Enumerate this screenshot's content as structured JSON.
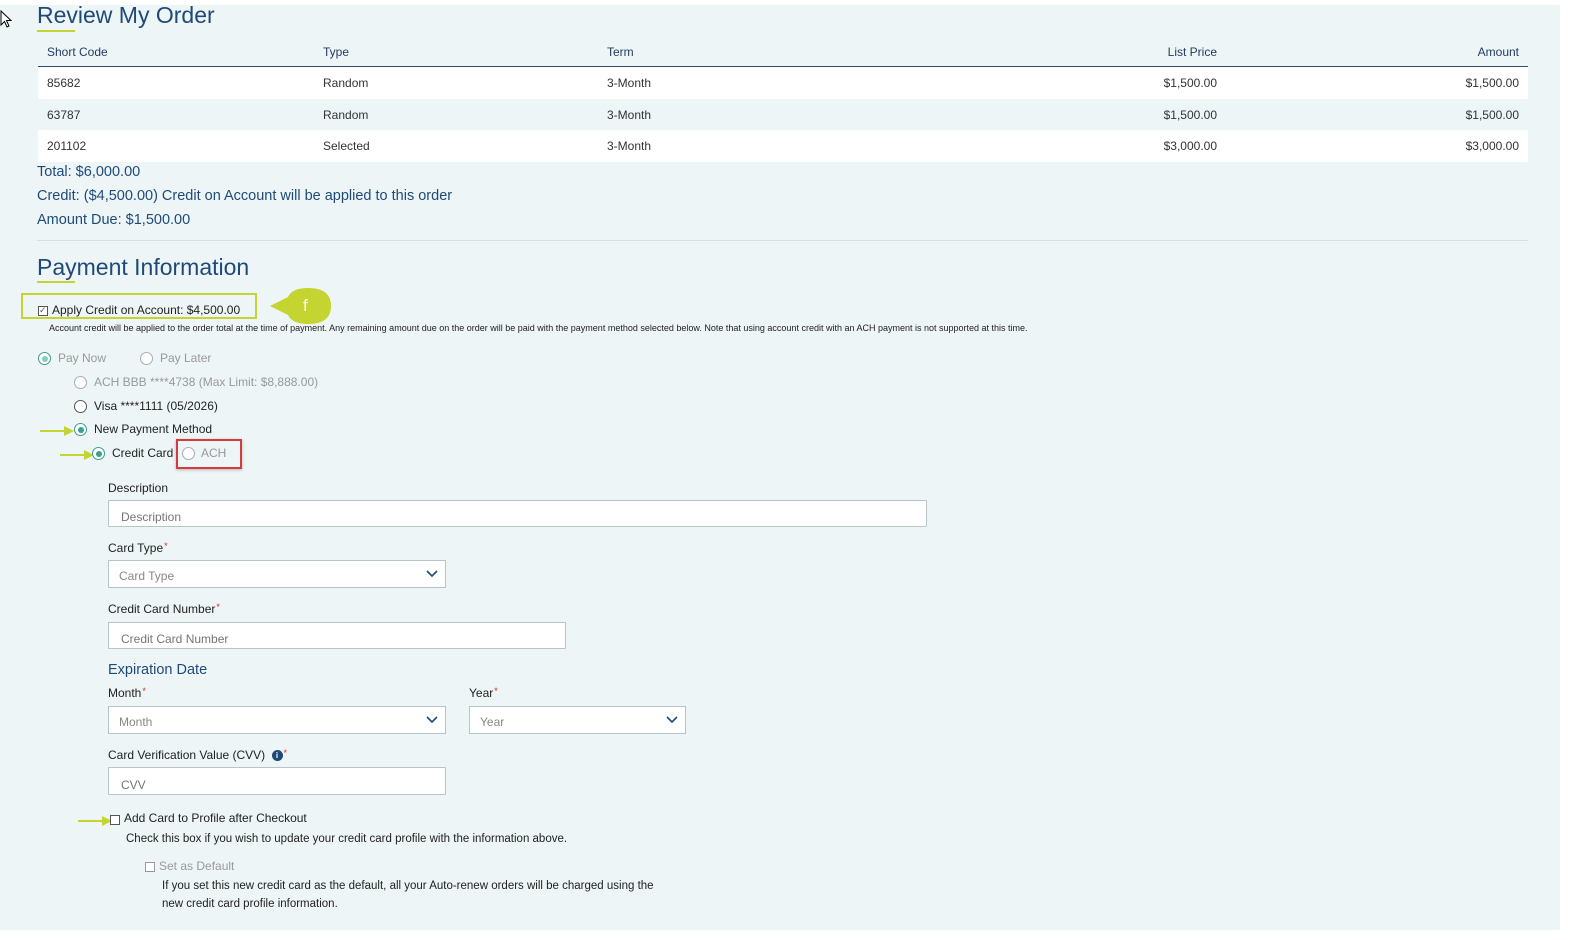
{
  "review": {
    "title": "Review My Order",
    "columns": [
      "Short Code",
      "Type",
      "Term",
      "List Price",
      "Amount"
    ],
    "rows": [
      {
        "short_code": "85682",
        "type": "Random",
        "term": "3-Month",
        "list_price": "$1,500.00",
        "amount": "$1,500.00"
      },
      {
        "short_code": "63787",
        "type": "Random",
        "term": "3-Month",
        "list_price": "$1,500.00",
        "amount": "$1,500.00"
      },
      {
        "short_code": "201102",
        "type": "Selected",
        "term": "3-Month",
        "list_price": "$3,000.00",
        "amount": "$3,000.00"
      }
    ],
    "total": "Total: $6,000.00",
    "credit": "Credit: ($4,500.00) Credit on Account will be applied to this order",
    "amount_due": "Amount Due: $1,500.00"
  },
  "payment": {
    "title": "Payment Information",
    "apply_credit_label": "Apply Credit on Account: $4,500.00",
    "apply_credit_checked": true,
    "callout_letter": "f",
    "credit_note": "Account credit will be applied to the order total at the time of payment. Any remaining amount due on the order will be paid with the payment method selected below. Note that using account credit with an ACH payment is not supported at this time.",
    "pay_now": "Pay Now",
    "pay_later": "Pay Later",
    "ach_saved": "ACH BBB ****4738 (Max Limit: $8,888.00)",
    "visa_saved": "Visa ****1111 (05/2026)",
    "new_method": "New Payment Method",
    "credit_card": "Credit Card",
    "ach": "ACH"
  },
  "form": {
    "description_label": "Description",
    "description_placeholder": "Description",
    "card_type_label": "Card Type",
    "card_type_placeholder": "Card Type",
    "cc_number_label": "Credit Card Number",
    "cc_number_placeholder": "Credit Card Number",
    "expiration_heading": "Expiration Date",
    "month_label": "Month",
    "month_placeholder": "Month",
    "year_label": "Year",
    "year_placeholder": "Year",
    "cvv_label": "Card Verification Value (CVV)",
    "cvv_placeholder": "CVV",
    "required_mark": "*",
    "info_glyph": "i",
    "add_card_label": "Add Card to Profile after Checkout",
    "add_card_note": "Check this box if you wish to update your credit card profile with the information above.",
    "set_default_label": "Set as Default",
    "default_note_1": "If you set this new credit card as the default, all your Auto-renew orders will be charged using the",
    "default_note_2": "new credit card profile information."
  },
  "colors": {
    "accent_green": "#c4d431",
    "heading_blue": "#1e4a78",
    "radio_teal": "#3a9f8f",
    "red_highlight": "#d63b3b"
  }
}
